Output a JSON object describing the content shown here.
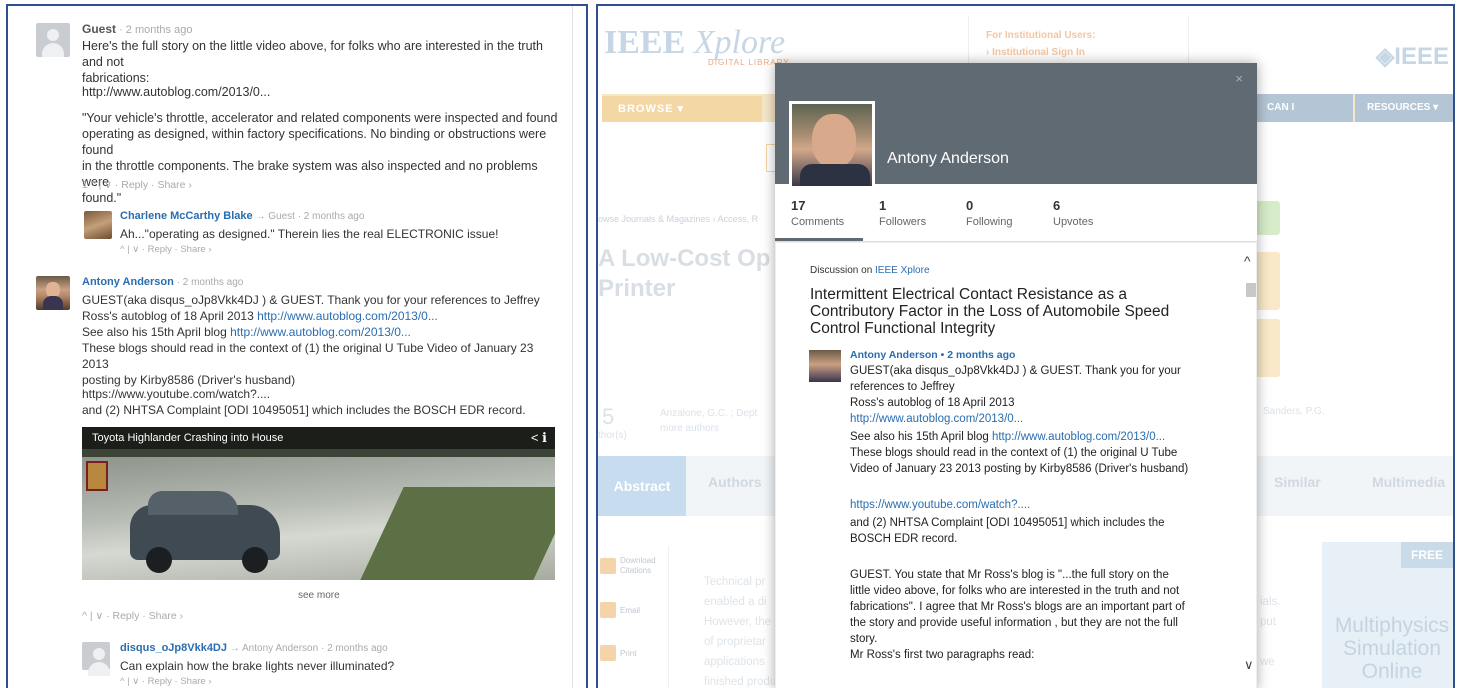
{
  "left": {
    "c1": {
      "author": "Guest",
      "time": "· 2 months ago",
      "text1": "Here's the full story on the little video above, for folks who are interested in the truth and not",
      "text2": "fabrications:",
      "link": "http://www.autoblog.com/2013/0...",
      "q1": "\"Your vehicle's throttle, accelerator and related components were inspected and found",
      "q2": "operating as designed, within factory specifications. No binding or obstructions were found",
      "q3": "in the throttle components. The brake system was also inspected and no problems were",
      "q4": "found.\"",
      "actions": "1 ^ | ∨ · Reply · Share ›"
    },
    "c2": {
      "author": "Charlene McCarthy Blake",
      "reply_to": "→ Guest",
      "time": "· 2 months ago",
      "text": "Ah...\"operating as designed.\" Therein lies the real ELECTRONIC issue!",
      "actions": "^ | ∨ · Reply · Share ›"
    },
    "c3": {
      "author": "Antony Anderson",
      "time": "· 2 months ago",
      "l1": "GUEST(aka disqus_oJp8Vkk4DJ ) & GUEST. Thank you for your references to Jeffrey",
      "l2a": "Ross's autoblog of 18 April 2013 ",
      "l2link": "http://www.autoblog.com/2013/0...",
      "l3a": "See also his 15th April blog ",
      "l3link": "http://www.autoblog.com/2013/0...",
      "l4": "These blogs should read in the context of (1) the original U Tube Video of January 23 2013",
      "l5": "posting by Kirby8586 (Driver's husband)",
      "yt": "https://www.youtube.com/watch?....",
      "l6": "and (2) NHTSA Complaint [ODI 10495051] which includes the BOSCH EDR record.",
      "video_title": "Toyota Highlander Crashing into House",
      "video_icons": "< ℹ",
      "see_more": "see more",
      "actions": "^ | ∨ · Reply · Share ›"
    },
    "c4": {
      "author": "disqus_oJp8Vkk4DJ",
      "reply_to": "→ Antony Anderson",
      "time": "· 2 months ago",
      "text": "Can explain how the brake lights never illuminated?",
      "actions": "^ | ∨ · Reply · Share ›"
    }
  },
  "right": {
    "logo_main": "IEEE",
    "logo_italic": "Xplore",
    "logo_sub": "DIGITAL LIBRARY",
    "inst_title": "For Institutional Users:",
    "inst_link": "› Institutional Sign In",
    "ieee_logo": "◈IEEE",
    "browse": "BROWSE ▾",
    "can_access": "CAN I ACCESS?",
    "resources": "RESOURCES ▾",
    "breadcrumb": "owse Journals & Magazines › Access, R",
    "title1": "A Low-Cost Op",
    "title2": "Printer",
    "authors_count": "5",
    "authors_label": "thor(s)",
    "authors_text": "Anzalone, G.C. ; Dept",
    "more_authors": "more authors",
    "sanders": "Sanders, P.G.",
    "tab_abstract": "Abstract",
    "tab_authors": "Authors",
    "tab_similar": "Similar",
    "tab_multimedia": "Multimedia",
    "side1": "Download Citations",
    "side2": "Email",
    "side3": "Print",
    "bg1": "Technical pr",
    "bg2": "enabled a di",
    "bg3": "However, the",
    "bg4": "of proprietar",
    "bg5": "applications",
    "bg6": "finished produ",
    "bg_r1": "ials.",
    "bg_r2": "put",
    "bg_r3": "we",
    "free": "FREE",
    "free_text": "Multiphysics Simulation Online"
  },
  "modal": {
    "close": "×",
    "name": "Antony Anderson",
    "stats": [
      {
        "n": "17",
        "l": "Comments"
      },
      {
        "n": "1",
        "l": "Followers"
      },
      {
        "n": "0",
        "l": "Following"
      },
      {
        "n": "6",
        "l": "Upvotes"
      }
    ],
    "disc_prefix": "Discussion on ",
    "disc_site": "IEEE Xplore",
    "title": "Intermittent Electrical Contact Resistance as a Contributory Factor in the Loss of Automobile Speed Control Functional Integrity",
    "author_line": "Antony Anderson • 2 months ago",
    "p1": "GUEST(aka disqus_oJp8Vkk4DJ ) & GUEST. Thank you for your",
    "p2": "references to Jeffrey",
    "p3": "Ross's autoblog of 18 April 2013",
    "p4": "http://www.autoblog.com/2013/0...",
    "p5a": "See also his 15th April blog ",
    "p5link": "http://www.autoblog.com/2013/0...",
    "p6": "These blogs should read in the context of (1) the original U Tube",
    "p7": "Video of January 23 2013 posting by Kirby8586 (Driver's husband)",
    "p8": "https://www.youtube.com/watch?....",
    "p9": "and (2) NHTSA Complaint [ODI 10495051] which includes the",
    "p10": "BOSCH EDR record.",
    "p11": "GUEST. You state that Mr Ross's blog is \"...the full story on the",
    "p12": "little video above, for folks who are interested in the truth and not",
    "p13": "fabrications\". I agree that Mr Ross's blogs are an important part of",
    "p14": "the story and provide useful information , but they are not the full",
    "p15": "story.",
    "p16": "Mr Ross's first two paragraphs read:",
    "scroll_up": "^",
    "scroll_down": "∨"
  }
}
